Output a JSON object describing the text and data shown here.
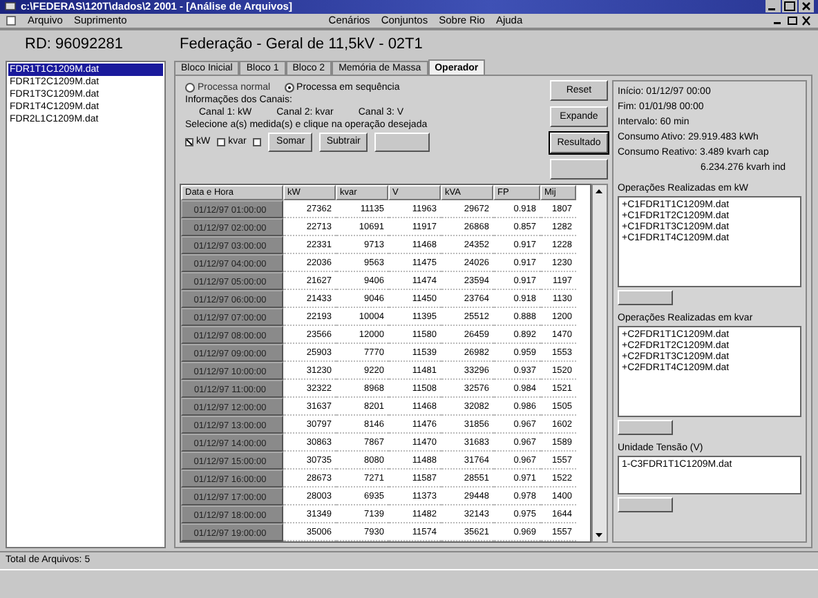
{
  "window": {
    "title": "c:\\FEDERAS\\120T\\dados\\2 2001 - [Análise de Arquivos]"
  },
  "menu": [
    "Arquivo",
    "Suprimento",
    "Cenários",
    "Conjuntos",
    "Sobre Rio",
    "Ajuda"
  ],
  "sidebar": {
    "label": "RD: 96092281",
    "items": [
      {
        "label": "FDR1T1C1209M.dat",
        "selected": true
      },
      {
        "label": "FDR1T2C1209M.dat",
        "selected": false
      },
      {
        "label": "FDR1T3C1209M.dat",
        "selected": false
      },
      {
        "label": "FDR1T4C1209M.dat",
        "selected": false
      },
      {
        "label": "FDR2L1C1209M.dat",
        "selected": false
      }
    ]
  },
  "heading": "Federação - Geral de 11,5kV - 02T1",
  "tabs": [
    {
      "label": "Bloco Inicial",
      "selected": false
    },
    {
      "label": "Bloco 1",
      "selected": false
    },
    {
      "label": "Bloco 2",
      "selected": false
    },
    {
      "label": "Memória de Massa",
      "selected": false
    },
    {
      "label": "Operador",
      "selected": true
    }
  ],
  "process_options": [
    {
      "label": "Processa normal",
      "selected": false
    },
    {
      "label": "Processa em sequência",
      "selected": true
    }
  ],
  "channels_info": {
    "title": "Informações dos Canais:",
    "channels": [
      "Canal 1: kW",
      "Canal 2: kvar",
      "Canal 3: V"
    ]
  },
  "instruction": "Selecione a(s) medida(s) e clique na operação desejada",
  "measures": [
    {
      "label": "kW",
      "checked": true
    },
    {
      "label": "kvar",
      "checked": false
    },
    {
      "checked": false
    }
  ],
  "operation_buttons": [
    "Somar",
    "Subtrair"
  ],
  "side_buttons": [
    "Reset",
    "Expande",
    "Resultado"
  ],
  "table": {
    "columns": [
      "Data e Hora",
      "kW",
      "kvar",
      "V",
      "kVA",
      "FP",
      "Mij"
    ],
    "rows": [
      [
        "01/12/97 01:00:00",
        "27362",
        "11135",
        "11963",
        "29672",
        "0.918",
        "1807"
      ],
      [
        "01/12/97 02:00:00",
        "22713",
        "10691",
        "11917",
        "26868",
        "0.857",
        "1282"
      ],
      [
        "01/12/97 03:00:00",
        "22331",
        "9713",
        "11468",
        "24352",
        "0.917",
        "1228"
      ],
      [
        "01/12/97 04:00:00",
        "22036",
        "9563",
        "11475",
        "24026",
        "0.917",
        "1230"
      ],
      [
        "01/12/97 05:00:00",
        "21627",
        "9406",
        "11474",
        "23594",
        "0.917",
        "1197"
      ],
      [
        "01/12/97 06:00:00",
        "21433",
        "9046",
        "11450",
        "23764",
        "0.918",
        "1130"
      ],
      [
        "01/12/97 07:00:00",
        "22193",
        "10004",
        "11395",
        "25512",
        "0.888",
        "1200"
      ],
      [
        "01/12/97 08:00:00",
        "23566",
        "12000",
        "11580",
        "26459",
        "0.892",
        "1470"
      ],
      [
        "01/12/97 09:00:00",
        "25903",
        "7770",
        "11539",
        "26982",
        "0.959",
        "1553"
      ],
      [
        "01/12/97 10:00:00",
        "31230",
        "9220",
        "11481",
        "33296",
        "0.937",
        "1520"
      ],
      [
        "01/12/97 11:00:00",
        "32322",
        "8968",
        "11508",
        "32576",
        "0.984",
        "1521"
      ],
      [
        "01/12/97 12:00:00",
        "31637",
        "8201",
        "11468",
        "32082",
        "0.986",
        "1505"
      ],
      [
        "01/12/97 13:00:00",
        "30797",
        "8146",
        "11476",
        "31856",
        "0.967",
        "1602"
      ],
      [
        "01/12/97 14:00:00",
        "30863",
        "7867",
        "11470",
        "31683",
        "0.967",
        "1589"
      ],
      [
        "01/12/97 15:00:00",
        "30735",
        "8080",
        "11488",
        "31764",
        "0.967",
        "1557"
      ],
      [
        "01/12/97 16:00:00",
        "28673",
        "7271",
        "11587",
        "28551",
        "0.971",
        "1522"
      ],
      [
        "01/12/97 17:00:00",
        "28003",
        "6935",
        "11373",
        "29448",
        "0.978",
        "1400"
      ],
      [
        "01/12/97 18:00:00",
        "31349",
        "7139",
        "11482",
        "32143",
        "0.975",
        "1644"
      ],
      [
        "01/12/97 19:00:00",
        "35006",
        "7930",
        "11574",
        "35621",
        "0.969",
        "1557"
      ]
    ]
  },
  "info": {
    "lines": [
      "Início: 01/12/97 00:00",
      "Fim: 01/01/98 00:00",
      "Intervalo: 60 min",
      "Consumo Ativo: 29.919.483 kWh",
      "Consumo Reativo: 3.489 kvarh cap",
      "6.234.276 kvarh ind"
    ]
  },
  "result_lists": [
    {
      "title": "Operações Realizadas em kW",
      "items": [
        "+C1FDR1T1C1209M.dat",
        "+C1FDR1T2C1209M.dat",
        "+C1FDR1T3C1209M.dat",
        "+C1FDR1T4C1209M.dat"
      ]
    },
    {
      "title": "Operações Realizadas em kvar",
      "items": [
        "+C2FDR1T1C1209M.dat",
        "+C2FDR1T2C1209M.dat",
        "+C2FDR1T3C1209M.dat",
        "+C2FDR1T4C1209M.dat"
      ]
    },
    {
      "title": "Unidade Tensão (V)",
      "items": [
        "1-C3FDR1T1C1209M.dat"
      ]
    }
  ],
  "status_bar": "Total de Arquivos: 5"
}
